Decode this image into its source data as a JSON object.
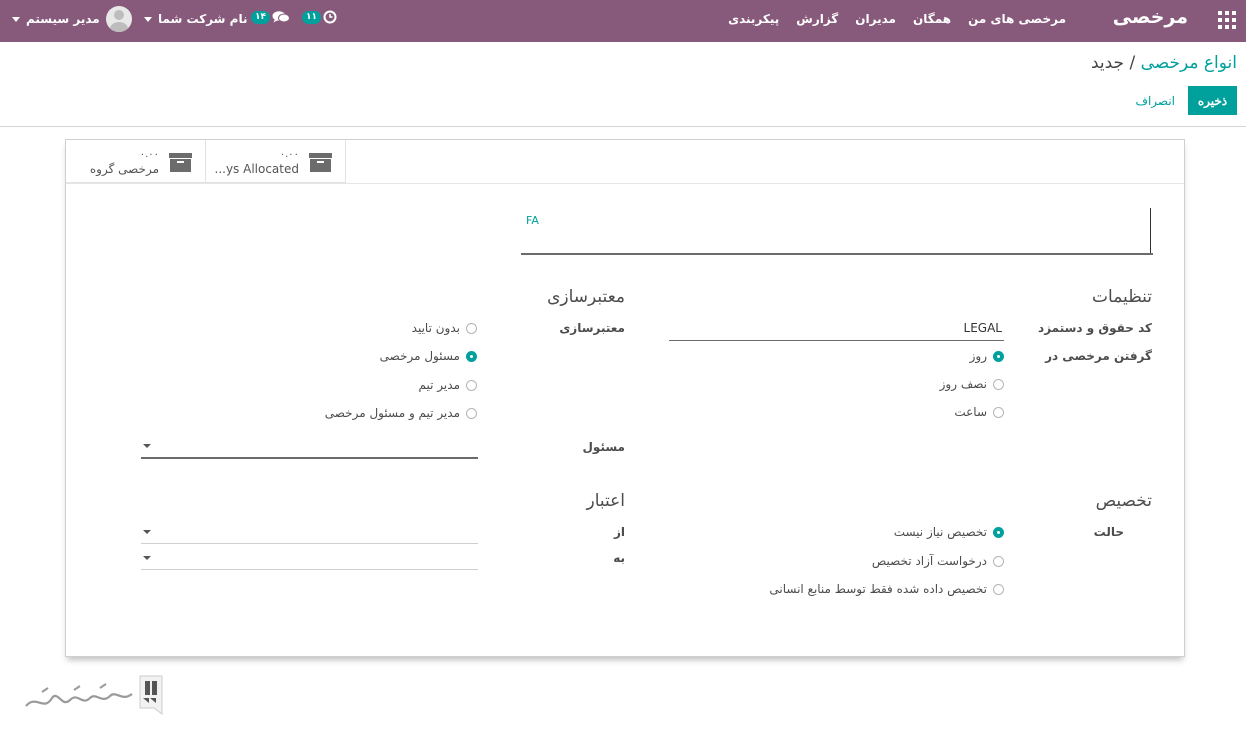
{
  "topbar": {
    "brand": "مرخصی",
    "menu": [
      "مرخصی های من",
      "همگان",
      "مدیران",
      "گزارش",
      "پیکربندی"
    ],
    "activity_count": "۱۱",
    "messages_count": "۱۴",
    "company": "نام شرکت شما",
    "user": "مدیر سیستم",
    "bar_color": "#875a7b",
    "accent_color": "#00a09d"
  },
  "control_panel": {
    "breadcrumb_parent": "انواع مرخصی",
    "breadcrumb_sep": "/",
    "breadcrumb_current": "جدید",
    "save_label": "ذخیره",
    "discard_label": "انصراف"
  },
  "button_box": [
    {
      "value": "۰.۰۰",
      "label": "مرخصی گروه"
    },
    {
      "value": "۰.۰۰",
      "label": "...ys Allocated"
    }
  ],
  "name_field": {
    "lang": "FA"
  },
  "settings": {
    "title": "تنظیمات",
    "code_label": "کد حقوق و دستمزد",
    "code_value": "LEGAL",
    "request_unit_label": "گرفتن مرخصی در",
    "request_unit_options": [
      {
        "label": "روز",
        "checked": true
      },
      {
        "label": "نصف روز",
        "checked": false
      },
      {
        "label": "ساعت",
        "checked": false
      }
    ]
  },
  "validation": {
    "title": "معتبرسازی",
    "label": "معتبرسازی",
    "options": [
      {
        "label": "بدون تایید",
        "checked": false
      },
      {
        "label": "مسئول مرخصی",
        "checked": true
      },
      {
        "label": "مدیر تیم",
        "checked": false
      },
      {
        "label": "مدیر تیم و مسئول مرخصی",
        "checked": false
      }
    ],
    "responsible_label": "مسئول"
  },
  "allocation": {
    "title": "تخصیص",
    "mode_label": "حالت",
    "options": [
      {
        "label": "تخصیص نیاز نیست",
        "checked": true
      },
      {
        "label": "درخواست آزاد تخصیص",
        "checked": false
      },
      {
        "label": "تخصیص داده شده فقط توسط منابع انسانی",
        "checked": false
      }
    ]
  },
  "validity": {
    "title": "اعتبار",
    "from_label": "از",
    "to_label": "به"
  }
}
